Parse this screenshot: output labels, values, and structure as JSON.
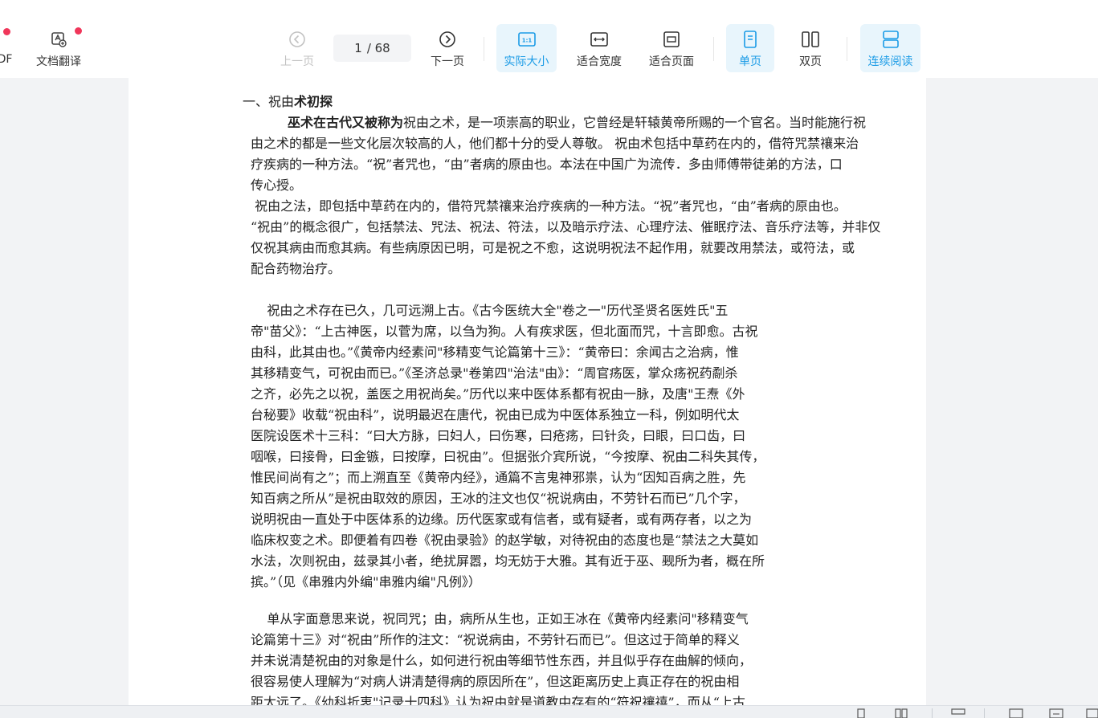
{
  "toolbar": {
    "pdf_label": "DF",
    "translate_label": "文档翻译",
    "prev_label": "上一页",
    "page_current": "1",
    "page_total": "/ 68",
    "next_label": "下一页",
    "actual_size_label": "实际大小",
    "fit_width_label": "适合宽度",
    "fit_page_label": "适合页面",
    "single_page_label": "单页",
    "double_page_label": "双页",
    "continuous_label": "连续阅读",
    "accent_color": "#1a9be6",
    "active_bg": "#e8f5fc",
    "badge_color": "#f0365a"
  },
  "document": {
    "heading_prefix": "一、祝由",
    "heading_bold": "术初探",
    "lines": [
      "由之术的都是一些文化层次较高的人，他们都十分的受人尊敬。 祝由术包括中草药在内的，借符咒禁禳来治",
      "疗疾病的一种方法。“祝”者咒也，“由”者病的原由也。本法在中国广为流传．多由师傅带徒弟的方法，口",
      "传心授。",
      " 祝由之法，即包括中草药在内的，借符咒禁禳来治疗疾病的一种方法。“祝”者咒也，“由”者病的原由也。",
      "“祝由”的概念很广，包括禁法、咒法、祝法、符法，以及暗示疗法、心理疗法、催眠疗法、音乐疗法等，并非仅",
      "仅祝其病由而愈其病。有些病原因已明，可是祝之不愈，这说明祝法不起作用，就要改用禁法，或符法，或",
      "配合药物治疗。"
    ],
    "para1_bold": "巫术在古代又被称为",
    "para1_rest": "祝由之术，是一项崇高的职业，它曾经是轩辕黄帝所赐的一个官名。当时能施行祝",
    "para2_lines": [
      "    祝由之术存在已久，几可远溯上古。《古今医统大全\"卷之一\"历代圣贤名医姓氏\"五",
      "帝\"苗父》：“上古神医，以菅为席，以刍为狗。人有疾求医，但北面而咒，十言即愈。古祝",
      "由科，此其由也。”《黄帝内经素问\"移精变气论篇第十三》：“黄帝曰：余闻古之治病，惟",
      "其移精变气，可祝由而已。”《圣济总录\"卷第四\"治法\"由》：“周官疡医，掌众疡祝药劀杀",
      "之齐，必先之以祝，盖医之用祝尚矣。”历代以来中医体系都有祝由一脉，及唐\"王焘《外",
      "台秘要》收载“祝由科”，说明最迟在唐代，祝由已成为中医体系独立一科，例如明代太",
      "医院设医术十三科：“曰大方脉，曰妇人，曰伤寒，曰疮疡，曰针灸，曰眼，曰口齿，曰",
      "咽喉，曰接骨，曰金镞，曰按摩，曰祝由”。但据张介宾所说，“今按摩、祝由二科失其传，",
      "惟民间尚有之”；而上溯直至《黄帝内经》，通篇不言鬼神邪祟，认为“因知百病之胜，先",
      "知百病之所从”是祝由取效的原因，王冰的注文也仅“祝说病由，不劳针石而已”几个字，",
      "说明祝由一直处于中医体系的边缘。历代医家或有信者，或有疑者，或有两存者，以之为",
      "临床权变之术。即便着有四卷《祝由录验》的赵学敏，对待祝由的态度也是“禁法之大莫如",
      "水法，次则祝由，兹录其小者，绝扰屏嚣，均无妨于大雅。其有近于巫、觋所为者，概在所",
      "摈。”（见《串雅内外编\"串雅内编\"凡例》）"
    ],
    "para3_lines": [
      "    单从字面意思来说，祝同咒；由，病所从生也，正如王冰在《黄帝内经素问\"移精变气",
      "论篇第十三》对“祝由”所作的注文：“祝说病由，不劳针石而已”。但这过于简单的释义",
      "并未说清楚祝由的对象是什么，如何进行祝由等细节性东西，并且似乎存在曲解的倾向，",
      "很容易使人理解为“对病人讲清楚得病的原因所在”，但这距离历史上真正存在的祝由相",
      "距太远了。《幼科折衷\"记录十四科》认为祝由就是道教中存有的“符祝禳禧”，而从“上古"
    ]
  }
}
